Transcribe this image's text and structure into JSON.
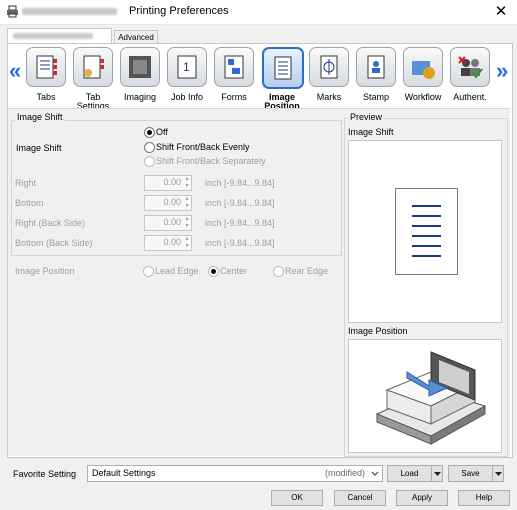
{
  "window": {
    "title": "Printing Preferences",
    "close_glyph": "✕"
  },
  "tabs": {
    "advanced": "Advanced"
  },
  "toolbar": {
    "prev_glyph": "«",
    "next_glyph": "»",
    "items": [
      {
        "label": "Tabs",
        "icon": "tabs-icon"
      },
      {
        "label": "Tab\nSettings",
        "icon": "tab-settings-icon"
      },
      {
        "label": "Imaging",
        "icon": "imaging-icon"
      },
      {
        "label": "Job Info",
        "icon": "job-info-icon"
      },
      {
        "label": "Forms",
        "icon": "forms-icon"
      },
      {
        "label": "Image\nPosition",
        "icon": "image-position-icon",
        "selected": true
      },
      {
        "label": "Marks",
        "icon": "marks-icon"
      },
      {
        "label": "Stamp",
        "icon": "stamp-icon"
      },
      {
        "label": "Workflow",
        "icon": "workflow-icon"
      },
      {
        "label": "Authent.",
        "icon": "authent-icon"
      }
    ]
  },
  "image_shift": {
    "group_title": "Image Shift",
    "label": "Image Shift",
    "options": [
      "Off",
      "Shift Front/Back Evenly",
      "Shift Front/Back Separately"
    ],
    "selected": "Off",
    "fields": [
      {
        "label": "Right",
        "value": "0.00",
        "unit": "inch [-9.84...9.84]"
      },
      {
        "label": "Bottom",
        "value": "0.00",
        "unit": "inch [-9.84...9.84]"
      },
      {
        "label": "Right (Back Side)",
        "value": "0.00",
        "unit": "inch [-9.84...9.84]"
      },
      {
        "label": "Bottom (Back Side)",
        "value": "0.00",
        "unit": "inch [-9.84...9.84]"
      }
    ]
  },
  "image_position": {
    "label": "Image Position",
    "options": [
      "Lead Edge",
      "Center",
      "Rear Edge"
    ],
    "selected": "Center"
  },
  "preview": {
    "group_title": "Preview",
    "shift_title": "Image Shift",
    "position_title": "Image Position"
  },
  "favorite": {
    "label": "Favorite Setting",
    "value": "Default Settings",
    "modified": "(modified)",
    "load": "Load",
    "save": "Save"
  },
  "buttons": {
    "ok": "OK",
    "cancel": "Cancel",
    "apply": "Apply",
    "help": "Help"
  },
  "colors": {
    "accent": "#2d6ccf",
    "arrow": "#2a6fd6",
    "preview_lines": "#1f3a8a"
  }
}
